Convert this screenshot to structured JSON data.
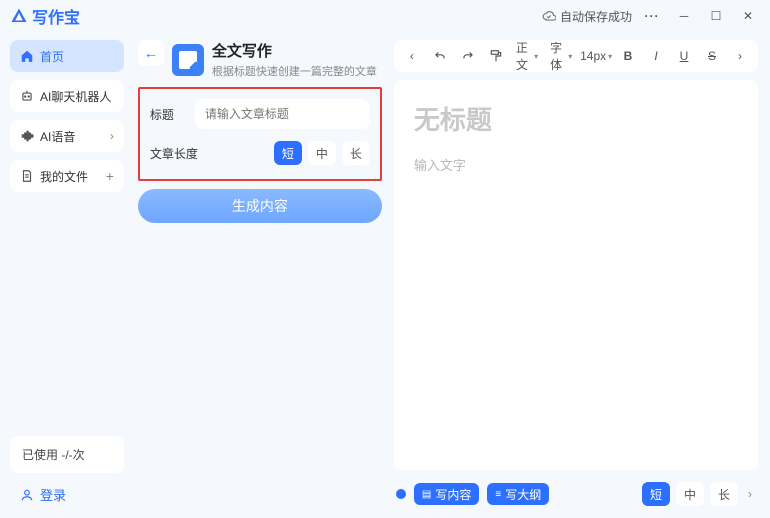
{
  "app": {
    "name": "写作宝"
  },
  "autosave": "自动保存成功",
  "sidebar": {
    "items": [
      {
        "label": "首页"
      },
      {
        "label": "AI聊天机器人"
      },
      {
        "label": "AI语音"
      },
      {
        "label": "我的文件"
      }
    ],
    "usage": "已使用 -/-次",
    "login": "登录"
  },
  "tool": {
    "title": "全文写作",
    "subtitle": "根据标题快速创建一篇完整的文章",
    "field_title": "标题",
    "title_placeholder": "请输入文章标题",
    "field_length": "文章长度",
    "length_options": [
      "短",
      "中",
      "长"
    ],
    "generate": "生成内容"
  },
  "editor": {
    "toolbar": {
      "style": "正文",
      "font": "字体",
      "size": "14px"
    },
    "doc_title": "无标题",
    "doc_body": "输入文字"
  },
  "bottom": {
    "write_content": "写内容",
    "write_outline": "写大纲",
    "length_options": [
      "短",
      "中",
      "长"
    ]
  }
}
